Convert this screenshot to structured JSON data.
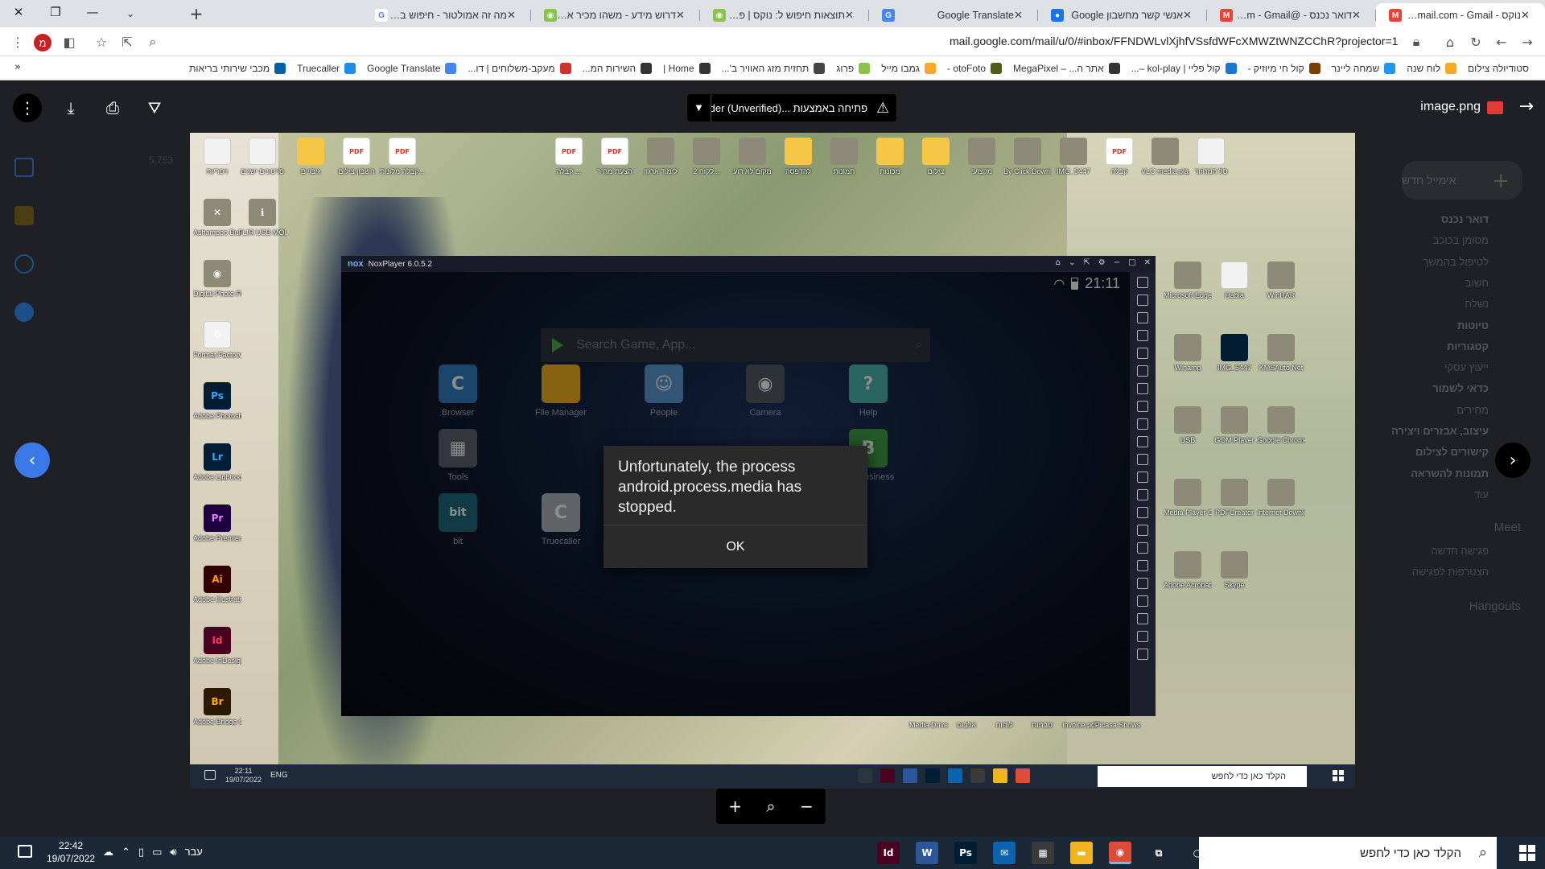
{
  "browser": {
    "tabs": [
      {
        "title": "נוקס - richa@gmail.com - Gmail",
        "favicon_color": "#ea4335",
        "favicon_char": "M",
        "active": true
      },
      {
        "title": "דואר נכנס - @gmail.com - Gmail",
        "favicon_color": "#ea4335",
        "favicon_char": "M"
      },
      {
        "title": "אנשי קשר מחשבון Google",
        "favicon_color": "#1a73e8",
        "favicon_char": "●"
      },
      {
        "title": "Google Translate",
        "favicon_color": "#4285f4",
        "favicon_char": "G"
      },
      {
        "title": "תוצאות חיפוש ל: נוקס | פרוג - דף",
        "favicon_color": "#8bc34a",
        "favicon_char": "◉"
      },
      {
        "title": "דרוש מידע - משהו מכיר את התו",
        "favicon_color": "#8bc34a",
        "favicon_char": "◉"
      },
      {
        "title": "מה זה אמולטור - חיפוש ב-Google",
        "favicon_color": "#ffffff",
        "favicon_char": "G"
      }
    ],
    "url": "mail.google.com/mail/u/0/#inbox/FFNDWLvlXjhfVSsfdWFcXMWZtWNZCChR?projector=1",
    "profile_initial": "מ",
    "bookmarks": [
      {
        "label": "מכבי שירותי בריאות",
        "color": "#0061a8"
      },
      {
        "label": "Truecaller",
        "color": "#1d8ee8"
      },
      {
        "label": "Google Translate",
        "color": "#4285f4"
      },
      {
        "label": "מעקב-משלוחים | דו...",
        "color": "#d32f2f"
      },
      {
        "label": "השירות המ...",
        "color": "#333333"
      },
      {
        "label": "Home |",
        "color": "#333333"
      },
      {
        "label": "תחזית מזג האוויר ב'...",
        "color": "#444444"
      },
      {
        "label": "פרוג",
        "color": "#8bc34a"
      },
      {
        "label": "גמבו מייל",
        "color": "#f9a825"
      },
      {
        "label": "otoFoto -",
        "color": "#4d5c1a"
      },
      {
        "label": "אתר ה... – MegaPixel",
        "color": "#333333"
      },
      {
        "label": "קול פליי | kol-play –...",
        "color": "#1976d2"
      },
      {
        "label": "קול חי מיוזיק -",
        "color": "#7b3f00"
      },
      {
        "label": "שמחה ליינר",
        "color": "#2196f3"
      },
      {
        "label": "לוח שנה",
        "color": "#f9a825"
      },
      {
        "label": "סטודיולה צילום",
        "color": "#ffffff"
      }
    ],
    "bookmarks_more": "»"
  },
  "gmail": {
    "compose": "אימייל חדש",
    "labels": [
      {
        "text": "דואר נכנס",
        "bold": true
      },
      {
        "text": "מסומן בכוכב"
      },
      {
        "text": "לטיפול בהמשך"
      },
      {
        "text": "חשוב"
      },
      {
        "text": "נשלח"
      },
      {
        "text": "טיוטות",
        "bold": true
      },
      {
        "text": "קטגוריות",
        "bold": true
      },
      {
        "text": "ייעוץ עסקי"
      },
      {
        "text": "כדאי לשמור",
        "bold": true
      },
      {
        "text": "מחירים"
      },
      {
        "text": "עיצוב, אבזרים ויצירה",
        "bold": true
      },
      {
        "text": "קישורים לצילום",
        "bold": true
      },
      {
        "text": "תמונות להשראה",
        "bold": true
      },
      {
        "text": "עוד"
      }
    ],
    "meet_header": "Meet",
    "meet_items": [
      "פגישה חדשה",
      "הצטרפות לפגישה"
    ],
    "hangouts_header": "Hangouts",
    "count_text": "5,753"
  },
  "viewer": {
    "filename": "image.png",
    "open_with": "פתיחה באמצעות ...older (Unverified)",
    "prev_icon": "‹",
    "next_icon": "›"
  },
  "nox": {
    "title": "NoxPlayer 6.0.5.2",
    "time": "21:11",
    "search_placeholder": "Search Game, App...",
    "apps": [
      {
        "label": "Browser",
        "color": "#2f7fc1",
        "glyph": "C"
      },
      {
        "label": "File Manager",
        "color": "#f2b51f",
        "glyph": ""
      },
      {
        "label": "People",
        "color": "#5b9bd5",
        "glyph": "☺"
      },
      {
        "label": "Camera",
        "color": "#555b66",
        "glyph": "◉"
      },
      {
        "label": "Help",
        "color": "#4db6ac",
        "glyph": "?"
      },
      {
        "label": "Tools",
        "color": "#5e6470",
        "glyph": "▦"
      },
      {
        "label": "WA Business",
        "color": "#43a047",
        "glyph": "B"
      },
      {
        "label": "bit",
        "color": "#1e6a7d",
        "glyph": "bit"
      },
      {
        "label": "Truecaller",
        "color": "#b0b6c0",
        "glyph": "C"
      }
    ],
    "dialog_message": "Unfortunately, the process android.process.media has stopped.",
    "dialog_ok": "OK"
  },
  "inner_desktop": {
    "left_icons": [
      {
        "label": "ויטריות",
        "kind": "doc",
        "glyph": ""
      },
      {
        "label": "Ashampoo Burning ...",
        "kind": "img",
        "glyph": "✕"
      },
      {
        "label": "Digital Photo Profession...",
        "kind": "img",
        "glyph": "◉"
      },
      {
        "label": "Format Factory",
        "kind": "doc",
        "glyph": "⚙"
      },
      {
        "label": "Adobe Photosho...",
        "kind": "ps",
        "glyph": "Ps"
      },
      {
        "label": "Adobe Lightroom",
        "kind": "lr",
        "glyph": "Lr"
      },
      {
        "label": "Adobe Premiere P...",
        "kind": "pr",
        "glyph": "Pr"
      },
      {
        "label": "Adobe Illustrator ...",
        "kind": "ai",
        "glyph": "Ai"
      },
      {
        "label": "Adobe InDesign ...",
        "kind": "id",
        "glyph": "Id"
      },
      {
        "label": "Adobe Bridge CC 2018",
        "kind": "br",
        "glyph": "Br"
      }
    ],
    "second_col": [
      {
        "label": "סרטונים ישנים",
        "kind": "doc",
        "glyph": ""
      },
      {
        "label": "FLIR USB MODEM",
        "kind": "img",
        "glyph": "ℹ"
      }
    ],
    "top_icons": [
      {
        "label": "גיבויים",
        "kind": "folder"
      },
      {
        "label": "חשבון צילום",
        "kind": "pdf"
      },
      {
        "label": "קבלה מלונות...",
        "kind": "pdf"
      },
      {
        "label": "קבלה ...",
        "kind": "pdf"
      },
      {
        "label": "הצעת מחיר",
        "kind": "pdf"
      },
      {
        "label": "לימוד ארגון",
        "kind": "img"
      },
      {
        "label": "לקוח 2...",
        "kind": "img"
      },
      {
        "label": "מקום לאירוע",
        "kind": "img"
      },
      {
        "label": "להדפסה",
        "kind": "folder"
      },
      {
        "label": "תמונות",
        "kind": "img"
      },
      {
        "label": "מכונות",
        "kind": "folder"
      },
      {
        "label": "צילום",
        "kind": "folder"
      },
      {
        "label": "מקצועי",
        "kind": "img"
      },
      {
        "label": "By Click Downloader",
        "kind": "img"
      },
      {
        "label": "IMG_5447",
        "kind": "img"
      },
      {
        "label": "קבלה",
        "kind": "pdf"
      },
      {
        "label": "VLC media player",
        "kind": "img"
      },
      {
        "label": "סל המחזור",
        "kind": "doc"
      }
    ],
    "right_icons": [
      {
        "label": "Microsoft Edge",
        "kind": "img"
      },
      {
        "label": "Habla",
        "kind": "doc"
      },
      {
        "label": "WinRAR",
        "kind": "img"
      },
      {
        "label": "Winamp",
        "kind": "img"
      },
      {
        "label": "IMG_5447",
        "kind": "ps"
      },
      {
        "label": "KMSAuto Net",
        "kind": "img"
      },
      {
        "label": "USB",
        "kind": "img"
      },
      {
        "label": "GOM Player",
        "kind": "img"
      },
      {
        "label": "Google Chrome",
        "kind": "img"
      },
      {
        "label": "Media Player Classic",
        "kind": "img"
      },
      {
        "label": "PDFCreator",
        "kind": "img"
      },
      {
        "label": "Internet Download...",
        "kind": "img"
      },
      {
        "label": "Adobe Acrobat DC",
        "kind": "img"
      },
      {
        "label": "Skype",
        "kind": "img"
      }
    ],
    "bottom_labels": [
      "Media Drive",
      "אלבום",
      "לוחות",
      "סבתות",
      "invoice.pdf",
      "Picasa Shows"
    ],
    "taskbar_time": "22:11",
    "taskbar_date": "19/07/2022",
    "taskbar_lang": "ENG",
    "taskbar_search": "הקלד כאן כדי לחפש"
  },
  "taskbar": {
    "time": "22:42",
    "date": "19/07/2022",
    "lang": "עבר",
    "search_placeholder": "הקלד כאן כדי לחפש",
    "apps": [
      {
        "name": "indesign",
        "color": "#49021f",
        "glyph": "Id"
      },
      {
        "name": "word",
        "color": "#2b579a",
        "glyph": "W"
      },
      {
        "name": "photoshop",
        "color": "#001d34",
        "glyph": "Ps"
      },
      {
        "name": "mail",
        "color": "#0a64ad",
        "glyph": "✉"
      },
      {
        "name": "calculator",
        "color": "#3a3a3a",
        "glyph": "▦"
      },
      {
        "name": "explorer",
        "color": "#f2b51f",
        "glyph": "▬"
      },
      {
        "name": "chrome",
        "color": "#dd4b39",
        "glyph": "◉",
        "active": true
      },
      {
        "name": "task-view",
        "color": "#1b2838",
        "glyph": "⧉"
      },
      {
        "name": "cortana",
        "color": "#1b2838",
        "glyph": "○"
      }
    ]
  },
  "zoom": {
    "plus": "+",
    "magnifier": "⌕",
    "minus": "−"
  }
}
